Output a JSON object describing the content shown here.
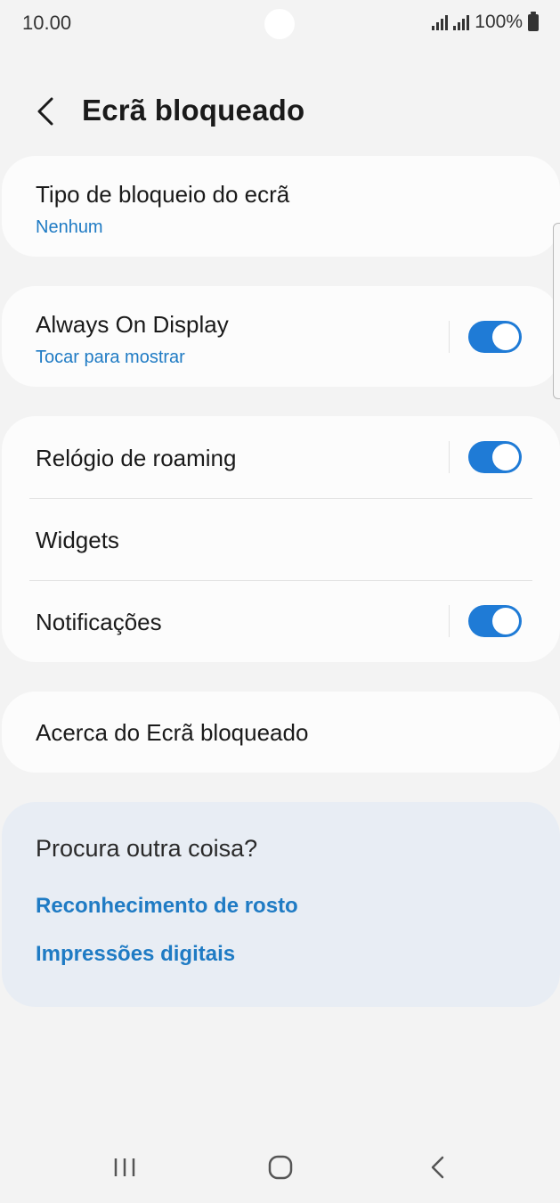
{
  "status_bar": {
    "time": "10.00",
    "battery": "100%",
    "icons": [
      "signal-icon",
      "signal-icon",
      "battery-icon"
    ]
  },
  "header": {
    "title": "Ecrã bloqueado",
    "back_icon": "chevron-left-icon"
  },
  "lock_type": {
    "title": "Tipo de bloqueio do ecrã",
    "value": "Nenhum"
  },
  "aod": {
    "title": "Always On Display",
    "subtitle": "Tocar para mostrar",
    "enabled": true
  },
  "settings_group": {
    "roaming_clock": {
      "title": "Relógio de roaming",
      "enabled": true
    },
    "widgets": {
      "title": "Widgets"
    },
    "notifications": {
      "title": "Notificações",
      "enabled": true
    }
  },
  "about": {
    "title": "Acerca do Ecrã bloqueado"
  },
  "suggestions": {
    "title": "Procura outra coisa?",
    "links": [
      "Reconhecimento de rosto",
      "Impressões digitais"
    ]
  },
  "navbar": {
    "icons": [
      "recent-apps-icon",
      "home-icon",
      "back-icon"
    ]
  },
  "colors": {
    "accent": "#1f7bd6",
    "link": "#1f7bc4",
    "background": "#f3f3f3",
    "card": "#fcfcfc",
    "suggest_bg": "#e8edf4"
  }
}
